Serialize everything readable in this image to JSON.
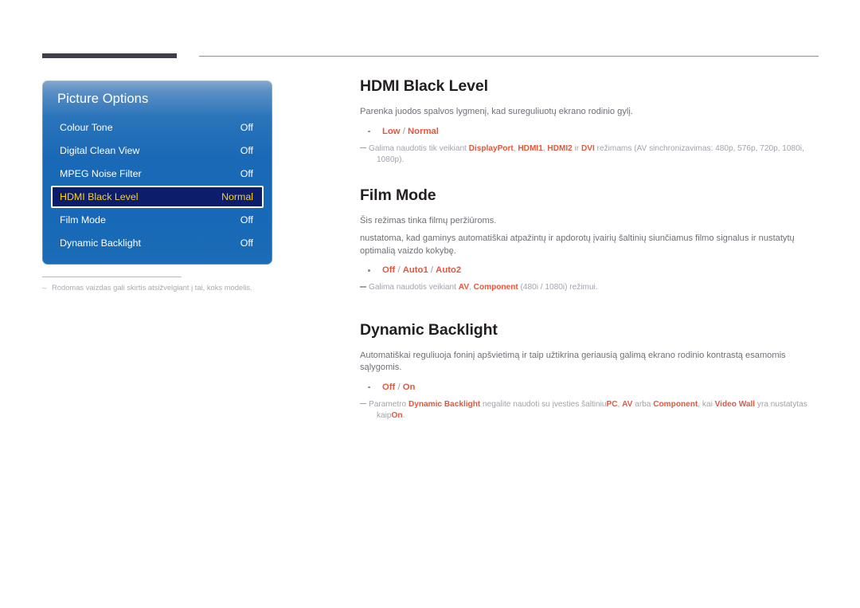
{
  "header": {
    "accent_bar_color": "#403d4d",
    "rule_color": "#8d8d96"
  },
  "osd_menu": {
    "title": "Picture Options",
    "selected_index": 3,
    "items": [
      {
        "label": "Colour Tone",
        "value": "Off"
      },
      {
        "label": "Digital Clean View",
        "value": "Off"
      },
      {
        "label": "MPEG Noise Filter",
        "value": "Off"
      },
      {
        "label": "HDMI Black Level",
        "value": "Normal"
      },
      {
        "label": "Film Mode",
        "value": "Off"
      },
      {
        "label": "Dynamic Backlight",
        "value": "Off"
      }
    ],
    "colors": {
      "panel_top": "#85a9cd",
      "panel_body": "#1a69b6",
      "selected_bg": "#0b1d6b",
      "selected_text": "#ffd400",
      "text": "#ffffff"
    }
  },
  "figure_note": {
    "dash": "–",
    "text": "Rodomas vaizdas gali skirtis atsižvelgiant į tai, koks modelis."
  },
  "sections": {
    "hdmi_black_level": {
      "title": "HDMI Black Level",
      "paragraph": "Parenka juodos spalvos lygmenį, kad sureguliuotų ekrano rodinio gylį.",
      "options": {
        "values": [
          "Low",
          "Normal"
        ],
        "separator": " / "
      },
      "note": {
        "lead": "Galima naudotis tik veikiant ",
        "terms": [
          "DisplayPort",
          "HDMI1",
          "HDMI2",
          "DVI"
        ],
        "mid1": ", ",
        "mid2": " ir ",
        "tail": " režimams (AV sinchronizavimas: 480p, 576p, 720p, 1080i,",
        "tail2": "1080p)."
      }
    },
    "film_mode": {
      "title": "Film Mode",
      "paragraph1": "Šis režimas tinka filmų peržiūroms.",
      "paragraph2": "nustatoma, kad gaminys automatiškai atpažintų ir apdorotų įvairių šaltinių siunčiamus filmo signalus ir nustatytų optimalią vaizdo kokybę.",
      "options": {
        "values": [
          "Off",
          "Auto1",
          "Auto2"
        ],
        "separator": " / "
      },
      "note": {
        "lead": "Galima naudotis veikiant ",
        "terms": [
          "AV",
          "Component"
        ],
        "mid": ", ",
        "tail": " (480i / 1080i) režimui."
      }
    },
    "dynamic_backlight": {
      "title": "Dynamic Backlight",
      "paragraph": "Automatiškai reguliuoja foninį apšvietimą ir taip užtikrina geriausią galimą ekrano rodinio kontrastą esamomis sąlygomis.",
      "options": {
        "values": [
          "Off",
          "On"
        ],
        "separator": " / "
      },
      "note": {
        "p1": "Parametro ",
        "b1": "Dynamic Backlight",
        "p2": " negalite naudoti su įvesties šaltiniu",
        "b2": "PC",
        "p3": ", ",
        "b3": "AV",
        "p4": " arba ",
        "b4": "Component",
        "p5": ", kai ",
        "b5": "Video Wall",
        "p6": " yra nustatytas",
        "p7": "kaip ",
        "b6": "On",
        "p8": "."
      }
    }
  },
  "accent_color": "#e4573c"
}
